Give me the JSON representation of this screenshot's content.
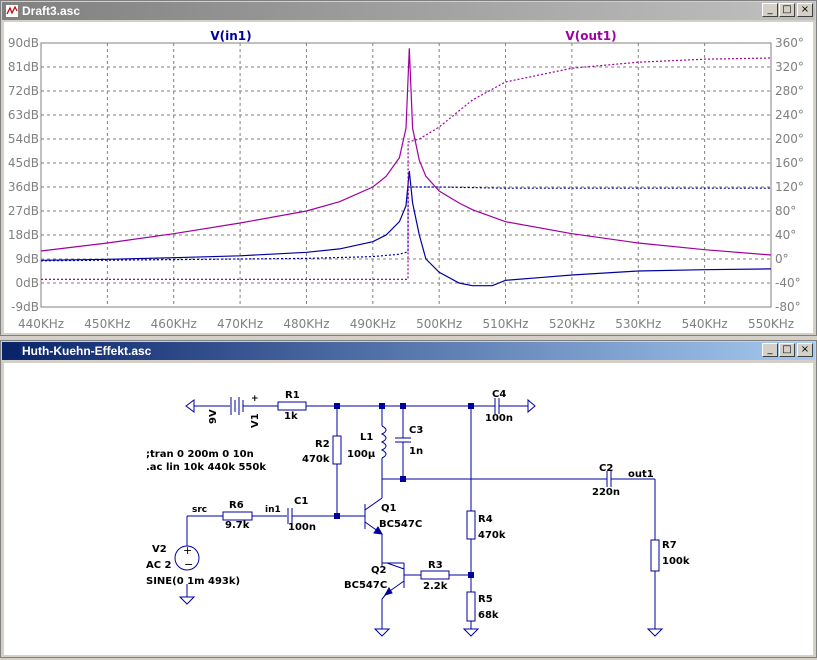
{
  "plot_window": {
    "title": "Draft3.asc",
    "buttons": {
      "minimize": "_",
      "maximize": "□",
      "close": "×"
    }
  },
  "schematic_window": {
    "title": "Huth-Kuehn-Effekt.asc",
    "buttons": {
      "minimize": "_",
      "maximize": "□",
      "close": "×"
    }
  },
  "chart_data": {
    "type": "line",
    "x_unit": "KHz",
    "xlim": [
      440,
      550
    ],
    "x_ticks": [
      "440KHz",
      "450KHz",
      "460KHz",
      "470KHz",
      "480KHz",
      "490KHz",
      "500KHz",
      "510KHz",
      "520KHz",
      "530KHz",
      "540KHz",
      "550KHz"
    ],
    "ylim_left": [
      -9,
      90
    ],
    "y_ticks_left": [
      "90dB",
      "81dB",
      "72dB",
      "63dB",
      "54dB",
      "45dB",
      "36dB",
      "27dB",
      "18dB",
      "9dB",
      "0dB",
      "-9dB"
    ],
    "ylim_right": [
      -80,
      360
    ],
    "y_ticks_right": [
      "360°",
      "320°",
      "280°",
      "240°",
      "200°",
      "160°",
      "120°",
      "80°",
      "40°",
      "0°",
      "-40°",
      "-80°"
    ],
    "grid": true,
    "colors": {
      "in1": "#0000a0",
      "out1": "#a000a0",
      "grid": "#808080",
      "axis_text": "#808080"
    },
    "series": [
      {
        "name": "V(in1)",
        "kind": "magnitude",
        "x": [
          440,
          450,
          460,
          470,
          480,
          485,
          490,
          492,
          494,
          495,
          495.5,
          496,
          497,
          498,
          500,
          503,
          505,
          508,
          510,
          515,
          520,
          530,
          540,
          550
        ],
        "y": [
          8.5,
          8.9,
          9.5,
          10.2,
          11.5,
          12.8,
          15.5,
          18,
          23,
          29,
          42,
          30,
          18,
          9,
          4,
          0,
          -1,
          -1,
          1,
          2,
          3,
          4.5,
          5,
          5.3
        ]
      },
      {
        "name": "V(in1)",
        "kind": "phase",
        "x": [
          440,
          460,
          480,
          490,
          494,
          495.3,
          495.31,
          500,
          510,
          520,
          530,
          540,
          550
        ],
        "y": [
          -3,
          -1,
          1,
          4,
          8,
          12,
          120,
          120,
          118,
          118,
          118,
          118,
          118
        ]
      },
      {
        "name": "V(out1)",
        "kind": "magnitude",
        "x": [
          440,
          450,
          460,
          470,
          480,
          485,
          490,
          492,
          494,
          495,
          495.5,
          496,
          497,
          498,
          500,
          503,
          505,
          510,
          520,
          530,
          540,
          550
        ],
        "y": [
          12,
          15,
          18.5,
          22.5,
          27,
          30.5,
          36,
          40,
          47,
          58,
          88,
          58,
          46,
          40,
          34.5,
          30,
          27.5,
          23,
          18.5,
          15,
          12.5,
          10.5
        ]
      },
      {
        "name": "V(out1)",
        "kind": "phase",
        "x": [
          440,
          460,
          480,
          494,
          495.3,
          495.31,
          497,
          500,
          505,
          510,
          520,
          530,
          540,
          550
        ],
        "y": [
          -34,
          -34,
          -34,
          -34,
          -34,
          195,
          200,
          220,
          265,
          295,
          318,
          328,
          333,
          335
        ]
      }
    ]
  },
  "schematic": {
    "labels": {
      "v1": "V1",
      "v1_val": "9V",
      "r1": "R1",
      "r1_val": "1k",
      "c4": "C4",
      "c4_val": "100n",
      "r2": "R2",
      "r2_val": "470k",
      "l1": "L1",
      "l1_val": "100µ",
      "c3": "C3",
      "c3_val": "1n",
      "directive_tran": ";tran 0 200m 0 10n",
      "directive_ac": ".ac lin 10k 440k 550k",
      "c2": "C2",
      "c2_val": "220n",
      "net_out1": "out1",
      "r6": "R6",
      "r6_val": "9.7k",
      "net_src": "src",
      "net_in1": "in1",
      "c1": "C1",
      "c1_val": "100n",
      "q1": "Q1",
      "q1_val": "BC547C",
      "r4": "R4",
      "r4_val": "470k",
      "r7": "R7",
      "r7_val": "100k",
      "v2": "V2",
      "v2_ac": "AC 2",
      "v2_sine": "SINE(0 1m 493k)",
      "q2": "Q2",
      "q2_val": "BC547C",
      "r3": "R3",
      "r3_val": "2.2k",
      "r5": "R5",
      "r5_val": "68k"
    }
  }
}
